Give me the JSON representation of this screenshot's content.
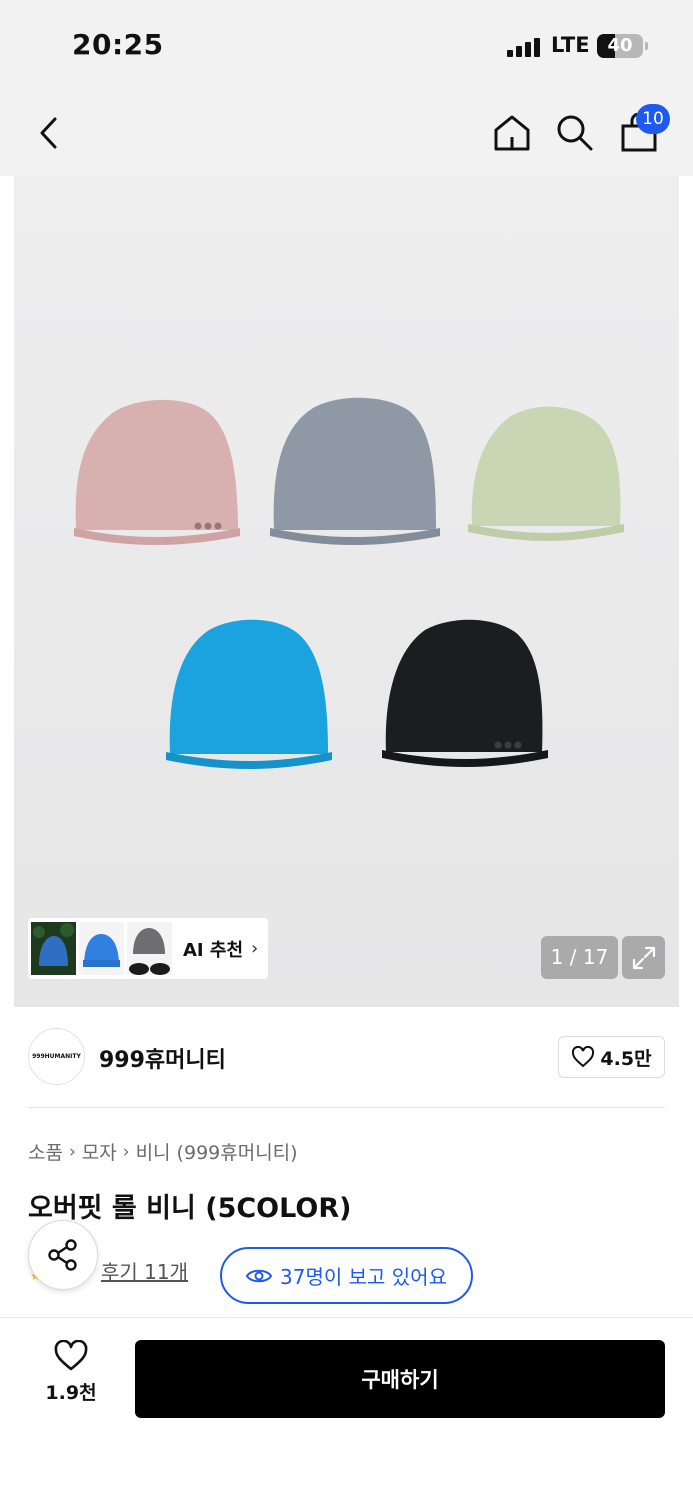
{
  "status_bar": {
    "time": "20:25",
    "network": "LTE",
    "battery": "40",
    "battery_level": 0.4
  },
  "header": {
    "back_icon": "chevron-left-icon",
    "home_icon": "home-icon",
    "search_icon": "search-icon",
    "cart_icon": "shopping-bag-icon",
    "cart_count": "10",
    "badge_color": "#1f5af0"
  },
  "gallery": {
    "hat_colors": [
      "#d9b0b0",
      "#8f99a6",
      "#c9d6b4",
      "#1aa3df",
      "#1b1d21"
    ],
    "ai_recommend_label": "AI 추천",
    "ai_thumbnails": [
      "thumb-green-backdrop",
      "thumb-blue-beanie",
      "thumb-gray-black-beanies"
    ],
    "page_counter": "1 / 17",
    "expand_icon": "expand-icon"
  },
  "brand": {
    "logo_text": "999HUMANITY",
    "name": "999휴머니티",
    "like_count": "4.5만"
  },
  "product": {
    "breadcrumb": [
      "소품",
      "모자",
      "비니 (999휴머니티)"
    ],
    "title": "오버핏 롤 비니 (5COLOR)",
    "review_link": "후기 11개",
    "viewers": "37명이 보고 있어요",
    "accent_color": "#1f5af0"
  },
  "bottom_bar": {
    "wish_count": "1.9천",
    "buy_label": "구매하기"
  }
}
